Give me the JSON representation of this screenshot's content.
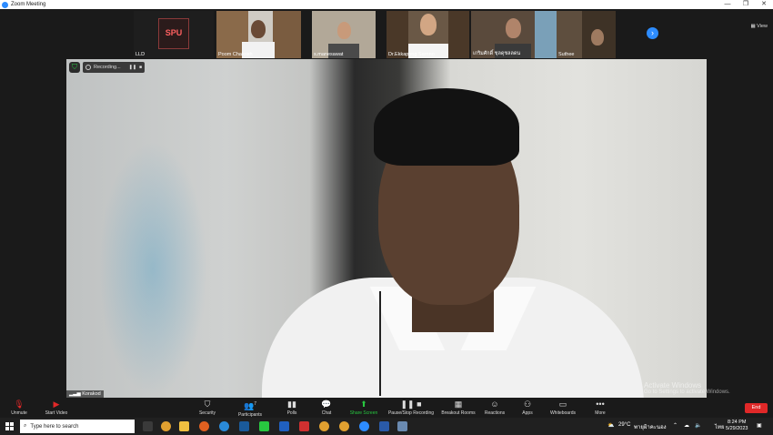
{
  "window": {
    "title": "Zoom Meeting",
    "controls": [
      "—",
      "❐",
      "✕"
    ]
  },
  "participants_strip": {
    "view_label": "View",
    "thumbs": [
      {
        "name": "LLD"
      },
      {
        "name": "Poom Chakrish"
      },
      {
        "name": "s.manesawat"
      },
      {
        "name": "Dr.Ekkapong Sarnno"
      },
      {
        "name": "เกริมศักดิ์ ชุลดุชลลดน"
      },
      {
        "name": "Suthee"
      }
    ],
    "logo_text": "SPU"
  },
  "main_video": {
    "speaker_name": "Korakod",
    "recording_label": "Recording..."
  },
  "watermark": {
    "line1": "Activate Windows",
    "line2": "Go to Settings to activate Windows."
  },
  "toolbar": {
    "unmute": "Unmute",
    "start_video": "Start Video",
    "security": "Security",
    "participants": "Participants",
    "participant_count": "7",
    "polls": "Polls",
    "chat": "Chat",
    "share_screen": "Share Screen",
    "recording": "Pause/Stop Recording",
    "breakout": "Breakout Rooms",
    "reactions": "Reactions",
    "apps": "Apps",
    "whiteboards": "Whiteboards",
    "more": "More",
    "end": "End"
  },
  "taskbar": {
    "search_placeholder": "Type here to search",
    "weather": "29°C",
    "weather_desc": "พายุฝ้าคะนอง",
    "lang": "ไทย",
    "time": "8:24 PM",
    "date": "5/29/2023"
  },
  "colors": {
    "zoom_blue": "#2d8cff",
    "green": "#28c840",
    "end_red": "#e02828"
  }
}
